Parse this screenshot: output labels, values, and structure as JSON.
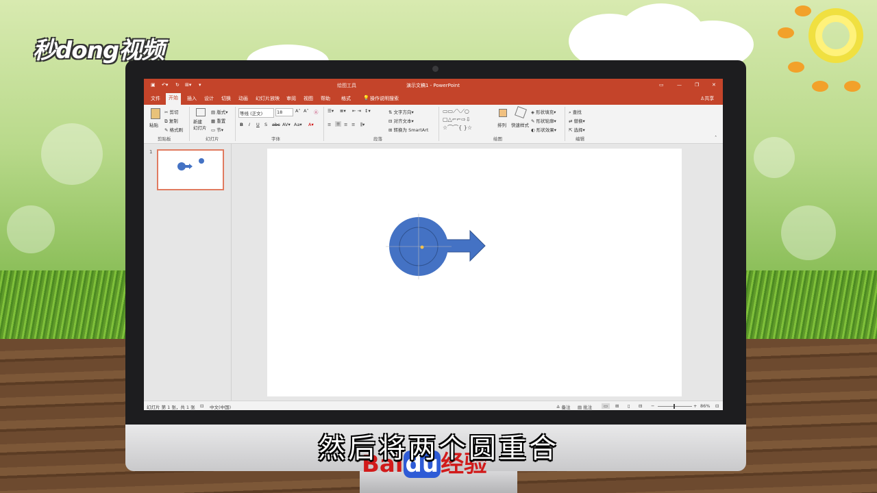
{
  "brand": {
    "logo_text": "秒dong视频"
  },
  "app": {
    "title": "演示文稿1 - PowerPoint",
    "contextual_tab_title": "绘图工具",
    "share_label": "共享",
    "tell_me": "操作说明搜索"
  },
  "tabs": [
    "文件",
    "开始",
    "插入",
    "设计",
    "切换",
    "动画",
    "幻灯片放映",
    "审阅",
    "视图",
    "帮助",
    "格式"
  ],
  "ribbon": {
    "clipboard": {
      "paste": "粘贴",
      "cut": "剪切",
      "copy": "复制",
      "format_painter": "格式刷",
      "group": "剪贴板"
    },
    "slides": {
      "new_slide": "新建\n幻灯片",
      "layout": "版式",
      "reset": "重置",
      "section": "节",
      "group": "幻灯片"
    },
    "font": {
      "font_name": "等线 (正文)",
      "font_size": "18",
      "group": "字体"
    },
    "paragraph": {
      "text_direction": "文字方向",
      "align_text": "对齐文本",
      "smartart": "转换为 SmartArt",
      "group": "段落"
    },
    "drawing": {
      "arrange": "排列",
      "quick_styles": "快速样式",
      "shape_fill": "形状填充",
      "shape_outline": "形状轮廓",
      "shape_effects": "形状效果",
      "group": "绘图"
    },
    "editing": {
      "find": "查找",
      "replace": "替换",
      "select": "选择",
      "group": "编辑"
    }
  },
  "thumbnails": {
    "slide_number": "1"
  },
  "status": {
    "slide_info": "幻灯片 第 1 张，共 1 张",
    "language": "中文(中国)",
    "notes": "备注",
    "comments": "批注",
    "zoom": "86%"
  },
  "shapes": {
    "fill_color": "#4472c4",
    "outline_color": "#2f528f"
  },
  "caption": "然后将两个圆重合",
  "watermark": {
    "bai": "Bai",
    "du": "du",
    "jingyan": "经验"
  }
}
